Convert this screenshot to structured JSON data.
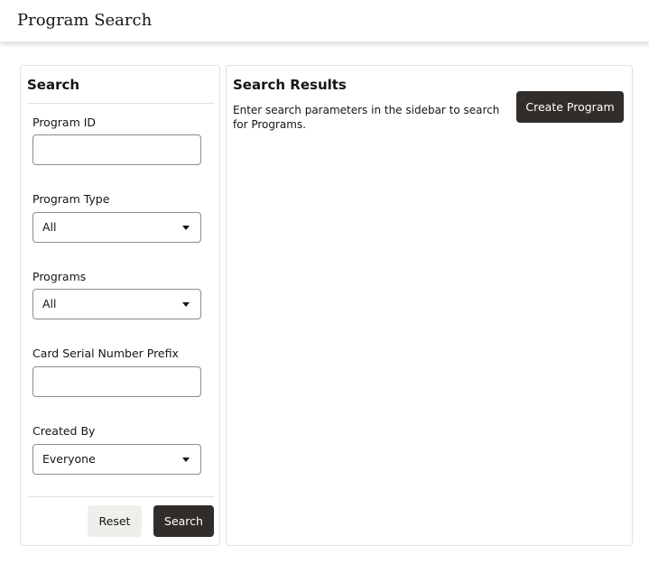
{
  "header": {
    "title": "Program Search"
  },
  "sidebar": {
    "title": "Search",
    "fields": {
      "program_id": {
        "label": "Program ID",
        "value": "",
        "placeholder": ""
      },
      "program_type": {
        "label": "Program Type",
        "value": "All"
      },
      "programs": {
        "label": "Programs",
        "value": "All"
      },
      "card_serial_prefix": {
        "label": "Card Serial Number Prefix",
        "value": "",
        "placeholder": ""
      },
      "created_by": {
        "label": "Created By",
        "value": "Everyone"
      }
    },
    "reset_label": "Reset",
    "search_label": "Search"
  },
  "results": {
    "title": "Search Results",
    "hint": "Enter search parameters in the sidebar to search for Programs.",
    "create_label": "Create Program"
  },
  "colors": {
    "primary_button": "#312d2a",
    "secondary_button": "#f0eeeb",
    "border": "#e4e1dd",
    "input_border": "#8f8b87"
  }
}
